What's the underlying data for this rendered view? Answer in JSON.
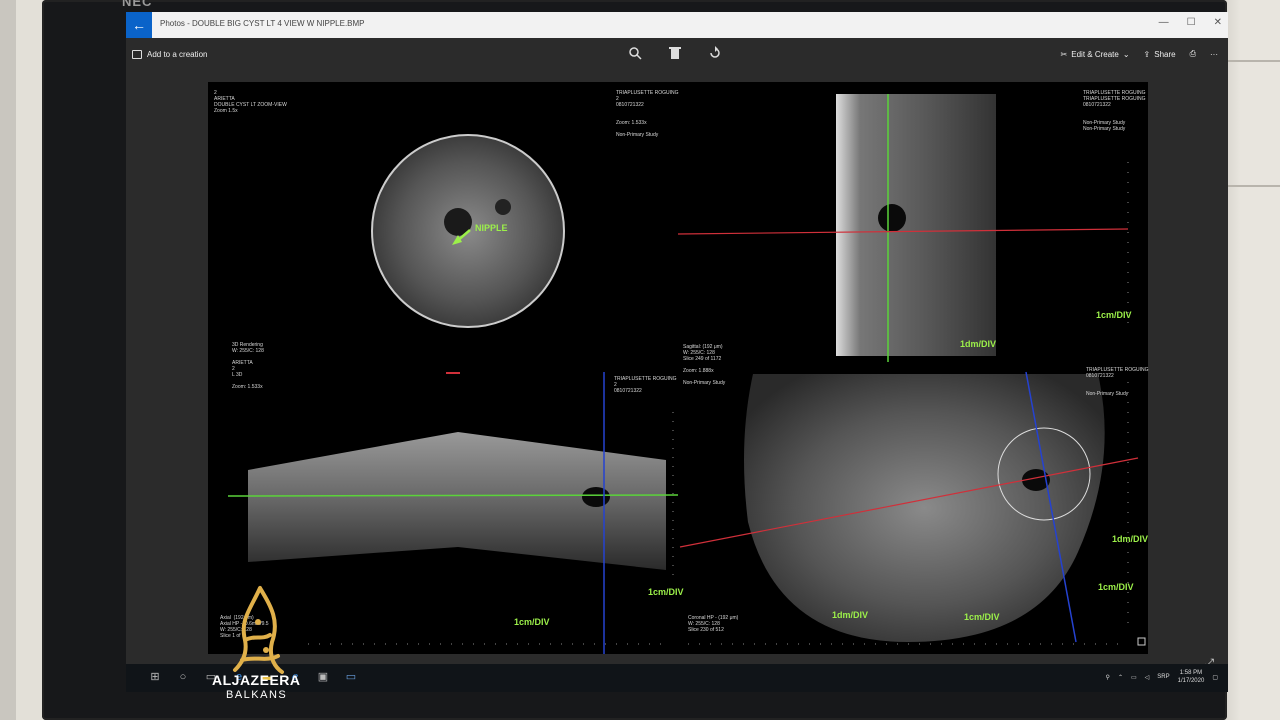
{
  "monitor": {
    "brand": "NEC"
  },
  "window": {
    "title": "Photos - DOUBLE BIG CYST LT 4 VIEW W NIPPLE.BMP",
    "controls": [
      "—",
      "☐",
      "✕"
    ]
  },
  "toolbar": {
    "add_to_creation": "Add to a creation",
    "edit_create": "Edit & Create",
    "share": "Share",
    "more": "···"
  },
  "scan": {
    "tl_header_left": "2\nARIETTA\nDOUBLE CYST LT ZOOM-VIEW\nZoom 1.5x",
    "tl_header_right": "TRIAPLUSETTE ROGUING\n2\n0810721322\n\n\nZoom: 1.533x\n\nNon-Primary Study",
    "tr_header": "TRIAPLUSETTE ROGUING\nTRIAPLUSETTE ROGUING\n0810721322\n\n\nNon-Primary Study\nNon-Primary Study",
    "bl_header": "3D Rendering\nW: 255/C: 128\n\nARIETTA\n2\nL 3D\n\nZoom: 1.533x",
    "bm_header": "Sagittal: (192 μm)\nW: 255/C: 128\nSlice 249 of 1172\n\nZoom: 1.888x\n\nNon-Primary Study",
    "bm_header_left": "TRIAPLUSETTE ROGUING\n2\n0810721322",
    "br_header": "TRIAPLUSETTE ROGUING\n0810721322\n\n\nNon-Primary Study",
    "bl_footer": "Axial  (192 μm)\nAxial HP -10.6mm/9.5\nW: 255/C: 128\nSlice 1 of 1",
    "bm_footer": "Coronal HP - (192 μm)\nW: 255/C: 128\nSlice 230 of 512",
    "nipple_label": "NIPPLE",
    "scales": [
      "1cm/DIV",
      "1dm/DIV",
      "1cm/DIV",
      "1cm/DIV",
      "1dm/DIV",
      "1cm/DIV",
      "1dm/DIV",
      "1cm/DIV"
    ]
  },
  "taskbar": {
    "lang": "SRP",
    "time": "1:58 PM",
    "date": "1/17/2020"
  },
  "overlay": {
    "channel_name": "ALJAZEERA",
    "channel_sub": "BALKANS"
  }
}
